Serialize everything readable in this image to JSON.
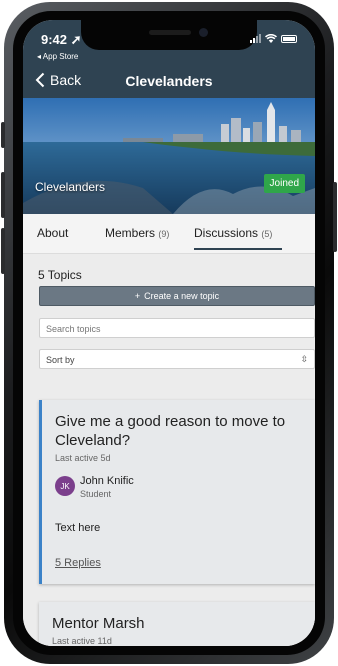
{
  "status": {
    "time": "9:42",
    "back_app": "◂ App Store"
  },
  "nav": {
    "back_label": "Back",
    "title": "Clevelanders"
  },
  "banner": {
    "group_name": "Clevelanders",
    "joined_label": "Joined"
  },
  "tabs": [
    {
      "label": "About",
      "count": ""
    },
    {
      "label": "Members",
      "count": "(9)"
    },
    {
      "label": "Discussions",
      "count": "(5)"
    }
  ],
  "topics": {
    "count_label": "5 Topics",
    "create_label": "Create a new topic",
    "search_placeholder": "Search topics",
    "sort_label": "Sort by"
  },
  "cards": [
    {
      "title": "Give me a good reason to move to Cleveland?",
      "last_active": "Last active 5d",
      "author_initials": "JK",
      "author_name": "John Knific",
      "author_role": "Student",
      "body": "Text here",
      "replies": "5 Replies"
    },
    {
      "title": "Mentor Marsh",
      "last_active": "Last active 11d"
    }
  ],
  "colors": {
    "nav_bg": "#2f4352",
    "joined": "#2fa64a",
    "accent": "#3b82c8",
    "avatar": "#7b3f8c"
  }
}
